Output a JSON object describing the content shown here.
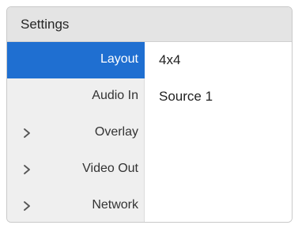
{
  "window": {
    "title": "Settings"
  },
  "sidebar": {
    "items": [
      {
        "label": "Layout",
        "selected": true,
        "expandable": false
      },
      {
        "label": "Audio In",
        "selected": false,
        "expandable": false
      },
      {
        "label": "Overlay",
        "selected": false,
        "expandable": true,
        "icon": "chevron-right-icon"
      },
      {
        "label": "Video Out",
        "selected": false,
        "expandable": true,
        "icon": "chevron-right-icon"
      },
      {
        "label": "Network",
        "selected": false,
        "expandable": true,
        "icon": "chevron-right-icon"
      }
    ]
  },
  "content": {
    "layout_value": "4x4",
    "audio_in_value": "Source 1"
  },
  "colors": {
    "selection": "#1f6fd1",
    "sidebar_bg": "#efefef",
    "titlebar_bg": "#e4e4e4"
  }
}
